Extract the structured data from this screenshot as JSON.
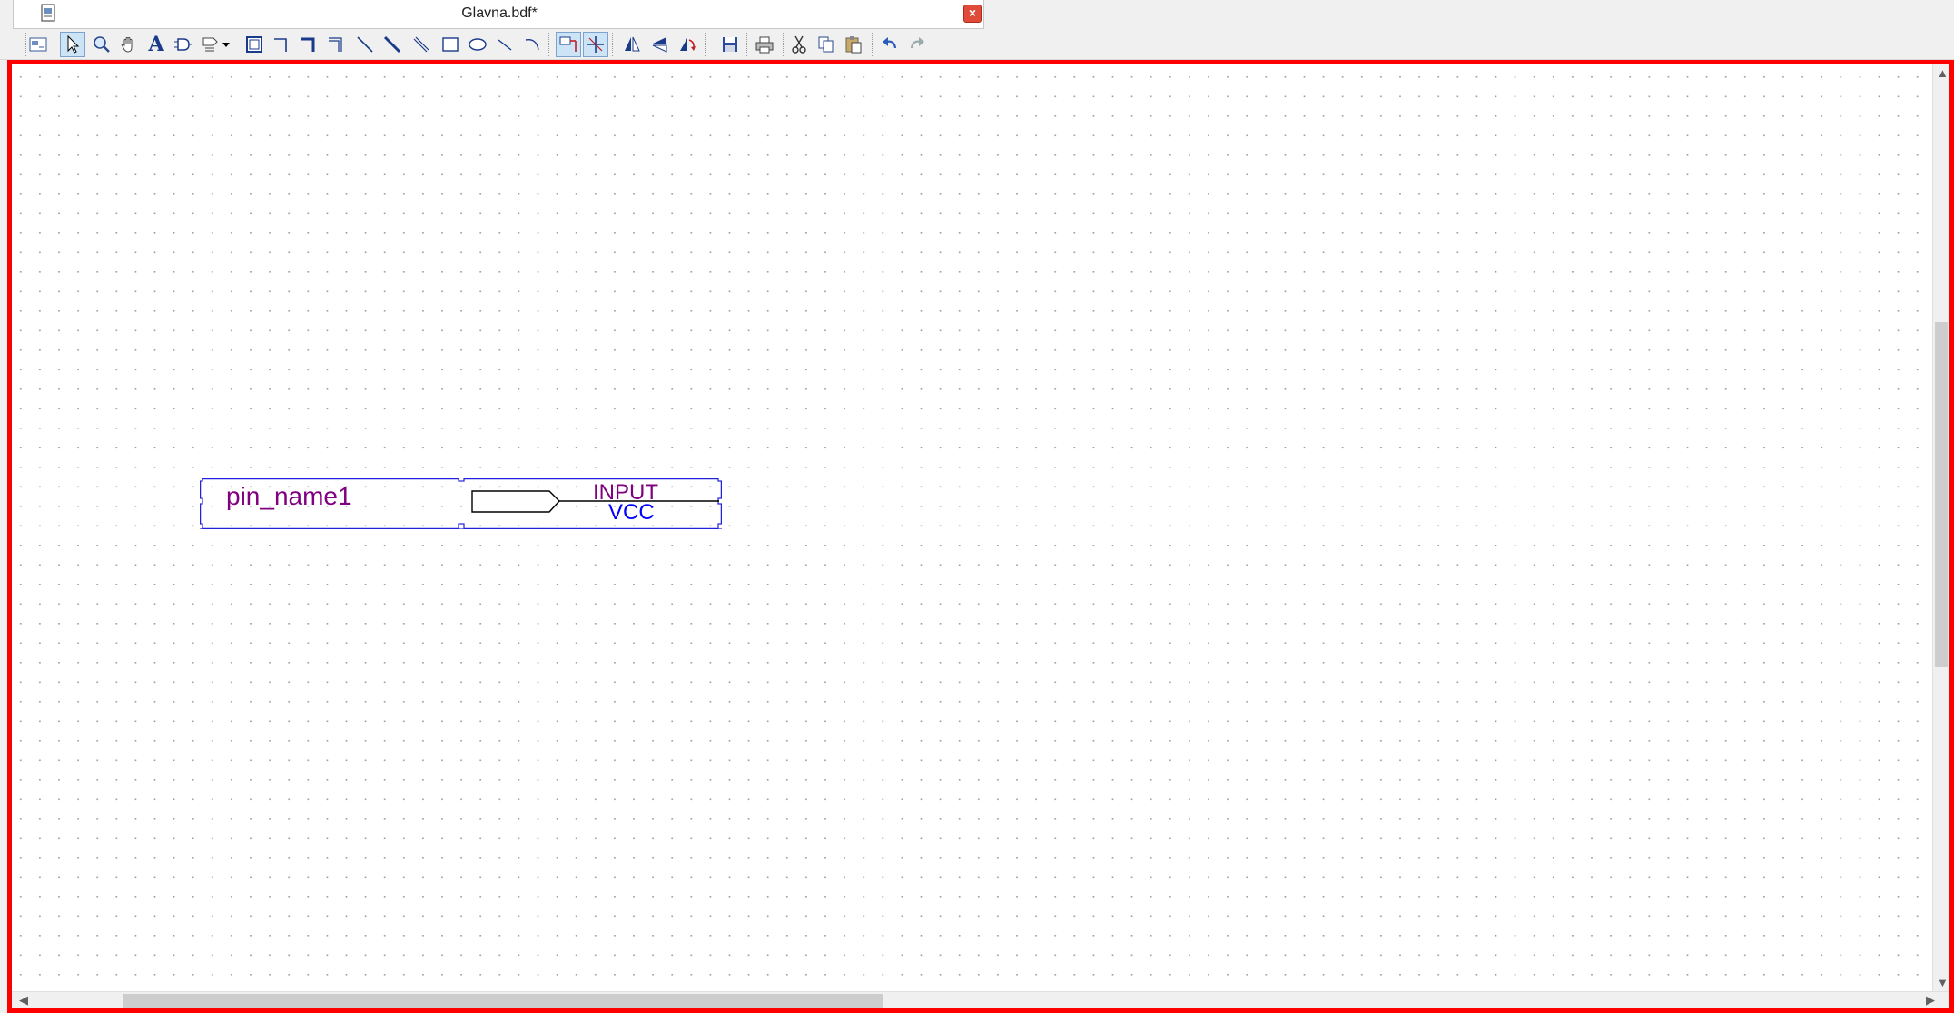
{
  "window": {
    "tab_title": "Glavna.bdf*",
    "close_symbol": "×"
  },
  "toolbar": {
    "icons": [
      "block-properties-icon",
      "selection-tool-icon",
      "zoom-tool-icon",
      "hand-tool-icon",
      "text-tool-icon",
      "symbol-tool-icon",
      "pin-tool-icon",
      "block-tool-icon",
      "orthogonal-node-icon",
      "orthogonal-bus-icon",
      "orthogonal-conduit-icon",
      "node-tool-icon",
      "bus-tool-icon",
      "conduit-tool-icon",
      "rectangle-tool-icon",
      "oval-tool-icon",
      "line-tool-icon",
      "arc-tool-icon",
      "rubberbanding-icon",
      "partial-line-selection-icon",
      "flip-horizontal-icon",
      "flip-vertical-icon",
      "rotate-icon",
      "save-icon",
      "print-icon",
      "cut-icon",
      "copy-icon",
      "paste-icon",
      "undo-icon",
      "redo-icon"
    ],
    "selected_tool": "selection-tool-icon",
    "text_tool_glyph": "A"
  },
  "schematic": {
    "pin": {
      "name": "pin_name1",
      "type": "INPUT",
      "default_value": "VCC"
    }
  },
  "colors": {
    "frame_border": "#ff0000",
    "pin_name": "#800080",
    "pin_type": "#800080",
    "pin_default": "#0000ff",
    "selection_box": "#2222dd",
    "grid_dot": "#9a9a9a"
  }
}
